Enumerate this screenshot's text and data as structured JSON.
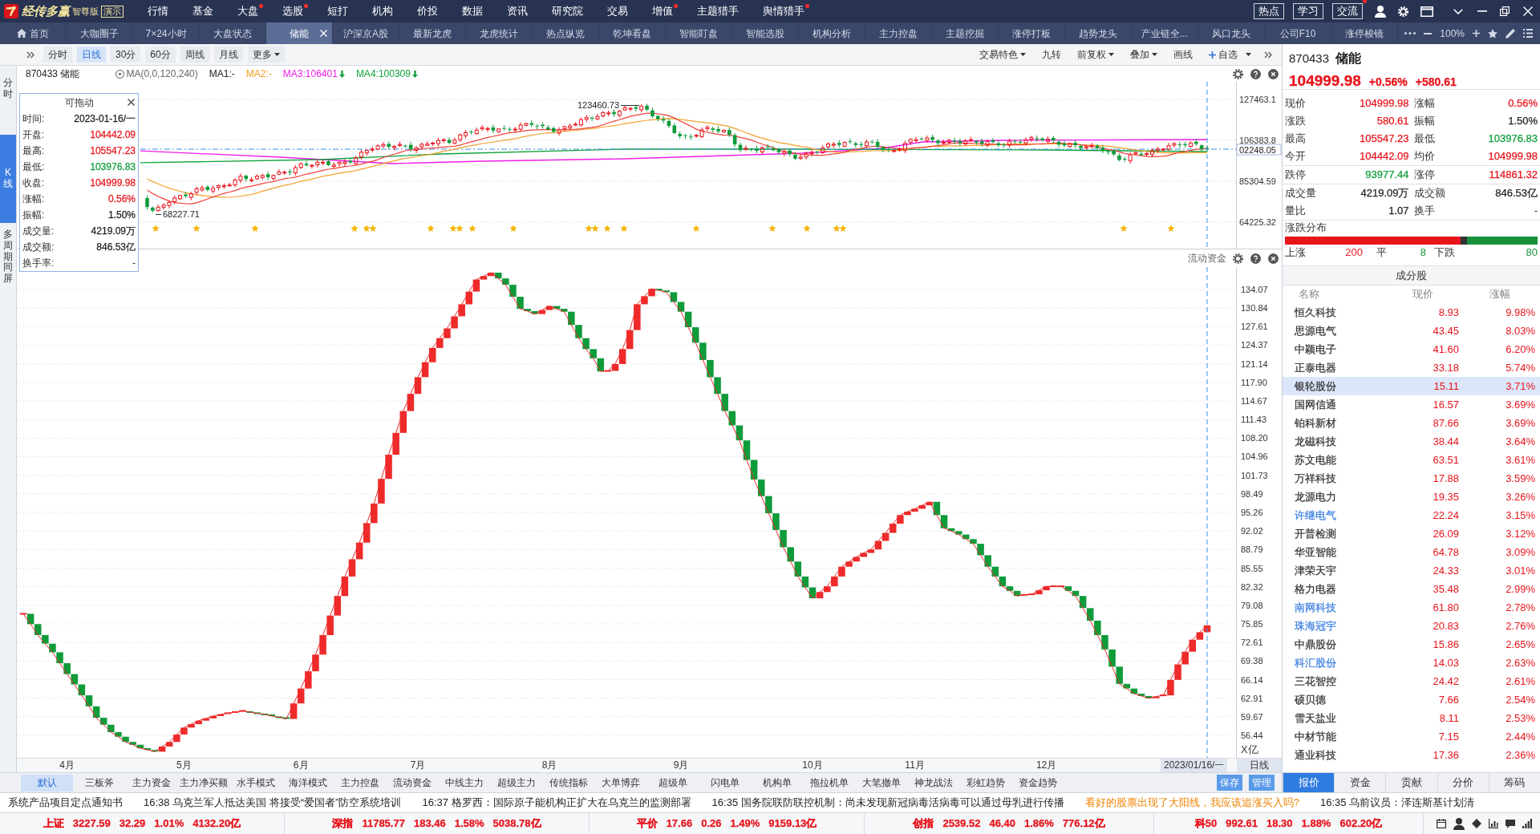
{
  "app": {
    "logo": "经传多赢",
    "edition": "智尊版",
    "badge": "演示"
  },
  "menu": [
    {
      "label": "行情",
      "dot": false
    },
    {
      "label": "基金",
      "dot": false
    },
    {
      "label": "大盘",
      "dot": true
    },
    {
      "label": "选股",
      "dot": true
    },
    {
      "label": "短打",
      "dot": false
    },
    {
      "label": "机构",
      "dot": false
    },
    {
      "label": "价投",
      "dot": false
    },
    {
      "label": "数据",
      "dot": false
    },
    {
      "label": "资讯",
      "dot": false
    },
    {
      "label": "研究院",
      "dot": false
    },
    {
      "label": "交易",
      "dot": false
    },
    {
      "label": "增值",
      "dot": true
    },
    {
      "label": "主题猎手",
      "dot": false
    },
    {
      "label": "舆情猎手",
      "dot": true
    }
  ],
  "top_buttons": [
    {
      "label": "热点",
      "dot": false
    },
    {
      "label": "学习",
      "dot": false
    },
    {
      "label": "交流",
      "dot": true
    }
  ],
  "tabs": [
    {
      "label": "首页",
      "kind": "home",
      "selected": false
    },
    {
      "label": "大咖圈子",
      "kind": "page",
      "selected": false
    },
    {
      "label": "7×24小时",
      "kind": "page",
      "selected": false
    },
    {
      "label": "大盘状态",
      "kind": "page",
      "selected": false
    },
    {
      "label": "储能",
      "kind": "page",
      "selected": true
    },
    {
      "label": "沪深京A股",
      "kind": "page",
      "selected": false
    },
    {
      "label": "最新龙虎",
      "kind": "page",
      "selected": false
    },
    {
      "label": "龙虎统计",
      "kind": "page",
      "selected": false
    },
    {
      "label": "热点纵览",
      "kind": "page",
      "selected": false
    },
    {
      "label": "乾坤看盘",
      "kind": "page",
      "selected": false
    },
    {
      "label": "智能盯盘",
      "kind": "page",
      "selected": false
    },
    {
      "label": "智能选股",
      "kind": "page",
      "selected": false
    },
    {
      "label": "机构分析",
      "kind": "page",
      "selected": false
    },
    {
      "label": "主力控盘",
      "kind": "page",
      "selected": false
    },
    {
      "label": "主题挖掘",
      "kind": "page",
      "selected": false
    },
    {
      "label": "涨停打板",
      "kind": "page",
      "selected": false
    },
    {
      "label": "趋势龙头",
      "kind": "page",
      "selected": false
    },
    {
      "label": "产业链全...",
      "kind": "page",
      "selected": false
    },
    {
      "label": "风口龙头",
      "kind": "page",
      "selected": false
    },
    {
      "label": "公司F10",
      "kind": "page",
      "selected": false
    },
    {
      "label": "涨停梭镜",
      "kind": "page",
      "selected": false
    }
  ],
  "zoom_text": "100%",
  "periods": [
    {
      "label": "分时",
      "kind": "plain",
      "selected": false
    },
    {
      "label": "日线",
      "kind": "plain",
      "selected": true
    },
    {
      "label": "30分",
      "kind": "plain",
      "selected": false
    },
    {
      "label": "60分",
      "kind": "plain",
      "selected": false
    },
    {
      "label": "周线",
      "kind": "plain",
      "selected": false
    },
    {
      "label": "月线",
      "kind": "plain",
      "selected": false
    },
    {
      "label": "更多",
      "kind": "dropdown",
      "selected": false
    }
  ],
  "tools": [
    {
      "label": "交易特色",
      "kind": "dropdown"
    },
    {
      "label": "九转",
      "kind": "plain"
    },
    {
      "label": "前复权",
      "kind": "dropdown"
    },
    {
      "label": "叠加",
      "kind": "dropdown"
    },
    {
      "label": "画线",
      "kind": "plain"
    },
    {
      "label": "自选",
      "kind": "add"
    }
  ],
  "side_tabs": [
    {
      "label": "分时",
      "selected": false
    },
    {
      "label": "K线",
      "selected": true
    },
    {
      "label": "多周期同屏",
      "selected": false
    }
  ],
  "kline_panel": {
    "symbol": "870433 储能",
    "ma_formula": "MA(0,0,120,240)",
    "ma_values": [
      {
        "label": "MA1:-",
        "color": "#222222",
        "falling": false
      },
      {
        "label": "MA2:-",
        "color": "#f39a1d",
        "falling": false
      },
      {
        "label": "MA3:106401",
        "color": "#ee1ee6",
        "falling": true
      },
      {
        "label": "MA4:100309",
        "color": "#12a13b",
        "falling": true
      }
    ],
    "high_label": "123460.73",
    "low_label": "68227.71",
    "y_labels": [
      "127463.1",
      "106383.8",
      "85304.59",
      "64225.32"
    ],
    "price_label": "02248.05"
  },
  "tooltip": {
    "title": "可拖动",
    "rows": [
      {
        "label": "时间:",
        "value": "2023-01-16/一",
        "color": "#222222"
      },
      {
        "label": "开盘:",
        "value": "104442.09",
        "color": "#e8141c"
      },
      {
        "label": "最高:",
        "value": "105547.23",
        "color": "#e8141c"
      },
      {
        "label": "最低:",
        "value": "103976.83",
        "color": "#0e9b3a"
      },
      {
        "label": "收盘:",
        "value": "104999.98",
        "color": "#e8141c"
      },
      {
        "label": "涨幅:",
        "value": "0.56%",
        "color": "#e8141c"
      },
      {
        "label": "振幅:",
        "value": "1.50%",
        "color": "#222222"
      },
      {
        "label": "成交量:",
        "value": "4219.09万",
        "color": "#222222"
      },
      {
        "label": "成交额:",
        "value": "846.53亿",
        "color": "#222222"
      },
      {
        "label": "换手率:",
        "value": "-"
      }
    ]
  },
  "flow_panel": {
    "chart_data": {
      "type": "line",
      "title": "流动资金",
      "ylabel": "X亿",
      "grid": true,
      "ylim": [
        52.53,
        137.98
      ],
      "yticks": [
        134.07,
        130.84,
        127.61,
        124.37,
        121.14,
        {
          "value": 117.9,
          "label": "117.90"
        },
        114.67,
        111.43,
        {
          "value": 108.2,
          "label": "108.20"
        },
        104.96,
        101.73,
        98.49,
        95.26,
        92.02,
        88.79,
        85.55,
        82.32,
        79.08,
        75.85,
        72.61,
        69.38,
        66.14,
        62.91,
        59.67,
        56.44
      ],
      "series": [
        {
          "color": "#ee2a2a",
          "values": [
            77.6,
            75.8,
            73.9,
            72.4,
            70.9,
            69.0,
            67.1,
            65.3,
            63.4,
            61.5,
            59.5,
            58.3,
            57.0,
            56.2,
            55.3,
            54.8,
            54.2,
            53.9,
            53.6,
            54.5,
            55.3,
            56.6,
            57.8,
            58.4,
            59.0,
            59.4,
            59.8,
            60.1,
            60.3,
            60.5,
            60.7,
            60.5,
            60.3,
            60.1,
            59.8,
            59.6,
            59.3,
            62.0,
            64.6,
            67.6,
            70.5,
            73.9,
            77.3,
            80.7,
            84.1,
            87.1,
            90.0,
            93.4,
            96.8,
            101.1,
            105.3,
            109.1,
            112.9,
            115.9,
            118.8,
            121.4,
            123.9,
            125.6,
            127.3,
            129.4,
            131.5,
            133.7,
            135.8,
            136.4,
            137.0,
            136.0,
            134.9,
            132.8,
            130.7,
            130.3,
            129.8,
            130.5,
            131.2,
            130.7,
            130.2,
            127.9,
            125.6,
            123.7,
            122.1,
            119.8,
            119.9,
            121.1,
            123.7,
            127.0,
            131.5,
            132.9,
            134.2,
            133.9,
            133.6,
            131.9,
            130.2,
            127.5,
            124.8,
            121.8,
            118.8,
            115.9,
            112.9,
            110.4,
            107.8,
            104.4,
            101.0,
            98.1,
            95.1,
            92.2,
            89.2,
            86.7,
            84.1,
            82.2,
            80.3,
            81.4,
            82.4,
            84.1,
            85.8,
            86.7,
            87.5,
            88.2,
            88.8,
            90.3,
            91.7,
            93.3,
            94.8,
            95.4,
            95.9,
            96.5,
            97.1,
            94.8,
            92.5,
            92.0,
            91.4,
            90.6,
            89.8,
            87.8,
            85.8,
            84.1,
            82.4,
            81.6,
            80.7,
            80.9,
            81.0,
            81.7,
            82.4,
            82.4,
            82.4,
            81.6,
            80.7,
            78.6,
            76.4,
            73.9,
            71.4,
            68.4,
            65.4,
            64.6,
            63.7,
            63.3,
            62.9,
            63.2,
            63.4,
            66.1,
            68.8,
            71.0,
            73.1,
            74.4,
            75.6
          ]
        }
      ]
    }
  },
  "x_axis": {
    "labels": [
      "4月",
      "5月",
      "6月",
      "7月",
      "8月",
      "9月",
      "10月",
      "11月",
      "12月"
    ],
    "date_label": "2023/01/16/一",
    "period_label": "日线"
  },
  "indicator_tabs": [
    {
      "label": "默认",
      "selected": true
    },
    {
      "label": "三板斧",
      "selected": false
    },
    {
      "label": "主力资金",
      "selected": false
    },
    {
      "label": "主力净买额",
      "selected": false
    },
    {
      "label": "水手模式",
      "selected": false
    },
    {
      "label": "海洋模式",
      "selected": false
    },
    {
      "label": "主力控盘",
      "selected": false
    },
    {
      "label": "流动资金",
      "selected": false
    },
    {
      "label": "中线主力",
      "selected": false
    },
    {
      "label": "超级主力",
      "selected": false
    },
    {
      "label": "传统指标",
      "selected": false
    },
    {
      "label": "大单博弈",
      "selected": false
    },
    {
      "label": "超级单",
      "selected": false
    },
    {
      "label": "闪电单",
      "selected": false
    },
    {
      "label": "机构单",
      "selected": false
    },
    {
      "label": "拖拉机单",
      "selected": false
    },
    {
      "label": "大笔撤单",
      "selected": false
    },
    {
      "label": "神龙战法",
      "selected": false
    },
    {
      "label": "彩虹趋势",
      "selected": false
    },
    {
      "label": "资金趋势",
      "selected": false
    }
  ],
  "indicator_actions": [
    "保存",
    "管理"
  ],
  "quote": {
    "code": "870433",
    "name": "储能",
    "price": "104999.98",
    "change_pct": "+0.56%",
    "change": "+580.61",
    "color": "#e8141c",
    "groups": [
      [
        [
          {
            "label": "现价",
            "value": "104999.98",
            "color": "#e8141c"
          },
          {
            "label": "涨幅",
            "value": "0.56%",
            "color": "#e8141c"
          }
        ],
        [
          {
            "label": "涨跌",
            "value": "580.61",
            "color": "#e8141c"
          },
          {
            "label": "振幅",
            "value": "1.50%",
            "color": "#222222"
          }
        ],
        [
          {
            "label": "最高",
            "value": "105547.23",
            "color": "#e8141c"
          },
          {
            "label": "最低",
            "value": "103976.83",
            "color": "#0e9b3a"
          }
        ],
        [
          {
            "label": "今开",
            "value": "104442.09",
            "color": "#e8141c"
          },
          {
            "label": "均价",
            "value": "104999.98",
            "color": "#e8141c"
          }
        ]
      ],
      [
        [
          {
            "label": "跌停",
            "value": "93977.44",
            "color": "#0e9b3a"
          },
          {
            "label": "涨停",
            "value": "114861.32",
            "color": "#e8141c"
          }
        ]
      ],
      [
        [
          {
            "label": "成交量",
            "value": "4219.09万",
            "color": "#222222"
          },
          {
            "label": "成交额",
            "value": "846.53亿",
            "color": "#222222"
          }
        ],
        [
          {
            "label": "量比",
            "value": "1.07",
            "color": "#222222"
          },
          {
            "label": "换手",
            "value": "-"
          }
        ]
      ]
    ],
    "distribution": {
      "title": "涨跌分布",
      "up_label": "上涨",
      "up": "200",
      "flat_label": "平",
      "flat": "8",
      "down_label": "下跌",
      "down": "80"
    },
    "constituents": {
      "title": "成分股",
      "columns": [
        "名称",
        "现价",
        "涨幅"
      ],
      "rows": [
        {
          "name": "恒久科技",
          "price": "8.93",
          "change": "9.98%",
          "color": "#333333",
          "selected": false
        },
        {
          "name": "思源电气",
          "price": "43.45",
          "change": "8.03%",
          "color": "#333333",
          "selected": false
        },
        {
          "name": "中颖电子",
          "price": "41.60",
          "change": "6.20%",
          "color": "#333333",
          "selected": false
        },
        {
          "name": "正泰电器",
          "price": "33.18",
          "change": "5.74%",
          "color": "#333333",
          "selected": false
        },
        {
          "name": "银轮股份",
          "price": "15.11",
          "change": "3.71%",
          "color": "#333333",
          "selected": true
        },
        {
          "name": "国网信通",
          "price": "16.57",
          "change": "3.69%",
          "color": "#333333",
          "selected": false
        },
        {
          "name": "铂科新材",
          "price": "87.66",
          "change": "3.69%",
          "color": "#333333",
          "selected": false
        },
        {
          "name": "龙磁科技",
          "price": "38.44",
          "change": "3.64%",
          "color": "#333333",
          "selected": false
        },
        {
          "name": "苏文电能",
          "price": "63.51",
          "change": "3.61%",
          "color": "#333333",
          "selected": false
        },
        {
          "name": "万祥科技",
          "price": "17.88",
          "change": "3.59%",
          "color": "#333333",
          "selected": false
        },
        {
          "name": "龙源电力",
          "price": "19.35",
          "change": "3.26%",
          "color": "#333333",
          "selected": false
        },
        {
          "name": "许继电气",
          "price": "22.24",
          "change": "3.15%",
          "color": "#3d7fe0",
          "selected": false
        },
        {
          "name": "开普检测",
          "price": "26.09",
          "change": "3.12%",
          "color": "#333333",
          "selected": false
        },
        {
          "name": "华亚智能",
          "price": "64.78",
          "change": "3.09%",
          "color": "#333333",
          "selected": false
        },
        {
          "name": "津荣天宇",
          "price": "24.33",
          "change": "3.01%",
          "color": "#333333",
          "selected": false
        },
        {
          "name": "格力电器",
          "price": "35.48",
          "change": "2.99%",
          "color": "#333333",
          "selected": false
        },
        {
          "name": "南网科技",
          "price": "61.80",
          "change": "2.78%",
          "color": "#3d7fe0",
          "selected": false
        },
        {
          "name": "珠海冠宇",
          "price": "20.83",
          "change": "2.76%",
          "color": "#3d7fe0",
          "selected": false
        },
        {
          "name": "中鼎股份",
          "price": "15.86",
          "change": "2.65%",
          "color": "#333333",
          "selected": false
        },
        {
          "name": "科汇股份",
          "price": "14.03",
          "change": "2.63%",
          "color": "#3d7fe0",
          "selected": false
        },
        {
          "name": "三花智控",
          "price": "24.42",
          "change": "2.61%",
          "color": "#333333",
          "selected": false
        },
        {
          "name": "硕贝德",
          "price": "7.66",
          "change": "2.54%",
          "color": "#333333",
          "selected": false
        },
        {
          "name": "雪天盐业",
          "price": "8.11",
          "change": "2.53%",
          "color": "#333333",
          "selected": false
        },
        {
          "name": "中材节能",
          "price": "7.15",
          "change": "2.44%",
          "color": "#333333",
          "selected": false
        },
        {
          "name": "通业科技",
          "price": "17.36",
          "change": "2.36%",
          "color": "#333333",
          "selected": false
        }
      ]
    }
  },
  "panel_tabs": [
    {
      "label": "报价",
      "selected": true
    },
    {
      "label": "资金",
      "selected": false
    },
    {
      "label": "贡献",
      "selected": false
    },
    {
      "label": "分价",
      "selected": false
    },
    {
      "label": "筹码",
      "selected": false
    }
  ],
  "news": [
    {
      "text": "系统产品项目定点通知书",
      "kind": "notice"
    },
    {
      "text": "16:38 乌克兰军人抵达美国 将接受“爱国者”防空系统培训",
      "kind": "news"
    },
    {
      "text": "16:37 格罗西：国际原子能机构正扩大在乌克兰的监测部署",
      "kind": "news"
    },
    {
      "text": "16:35 国务院联防联控机制：尚未发现新冠病毒活病毒可以通过母乳进行传播",
      "kind": "news"
    },
    {
      "text": "看好的股票出现了大阳线，我应该追涨买入吗?",
      "kind": "promo"
    },
    {
      "text": "16:35 乌前议员：泽连斯基计划清",
      "kind": "news"
    }
  ],
  "indices": [
    {
      "name": "上证",
      "price": "3227.59",
      "change": "32.29",
      "pct": "1.01%",
      "amount": "4132.20亿",
      "color": "#e8141c"
    },
    {
      "name": "深指",
      "price": "11785.77",
      "change": "183.46",
      "pct": "1.58%",
      "amount": "5038.78亿",
      "color": "#e8141c"
    },
    {
      "name": "平价",
      "price": "17.66",
      "change": "0.26",
      "pct": "1.49%",
      "amount": "9159.13亿",
      "color": "#e8141c"
    },
    {
      "name": "创指",
      "price": "2539.52",
      "change": "46.40",
      "pct": "1.86%",
      "amount": "776.12亿",
      "color": "#e8141c"
    },
    {
      "name": "科50",
      "price": "992.61",
      "change": "18.30",
      "pct": "1.88%",
      "amount": "602.20亿",
      "color": "#e8141c"
    }
  ]
}
